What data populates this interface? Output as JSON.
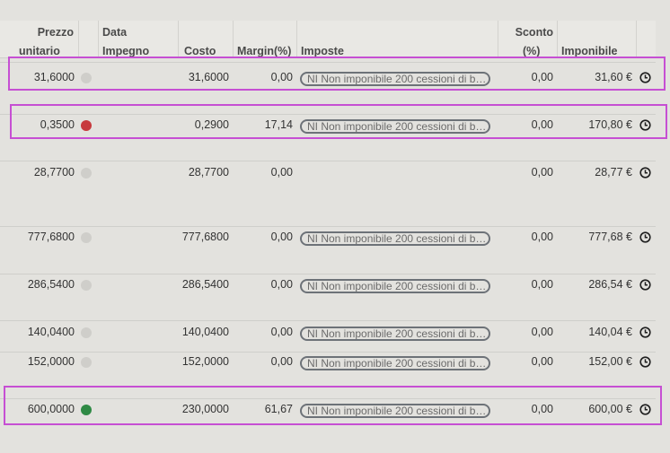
{
  "header": {
    "prezzo_l1": "Prezzo",
    "prezzo_l2": "unitario",
    "data_l1": "Data",
    "data_l2": "Impegno",
    "costo": "Costo",
    "margin": "Margin(%)",
    "imposte": "Imposte",
    "sconto_l1": "Sconto",
    "sconto_l2": "(%)",
    "imponibile": "Imponibile"
  },
  "rows": [
    {
      "prezzo": "31,6000",
      "status": "grey",
      "costo": "31,6000",
      "margin": "0,00",
      "imposte": "NI Non imponibile 200 cessioni di b…",
      "sconto": "0,00",
      "imponibile": "31,60 €"
    },
    {
      "prezzo": "0,3500",
      "status": "red",
      "costo": "0,2900",
      "margin": "17,14",
      "imposte": "NI Non imponibile 200 cessioni di b…",
      "sconto": "0,00",
      "imponibile": "170,80 €"
    },
    {
      "prezzo": "28,7700",
      "status": "grey",
      "costo": "28,7700",
      "margin": "0,00",
      "imposte": "",
      "sconto": "0,00",
      "imponibile": "28,77 €"
    },
    {
      "prezzo": "777,6800",
      "status": "grey",
      "costo": "777,6800",
      "margin": "0,00",
      "imposte": "NI Non imponibile 200 cessioni di b…",
      "sconto": "0,00",
      "imponibile": "777,68 €"
    },
    {
      "prezzo": "286,5400",
      "status": "grey",
      "costo": "286,5400",
      "margin": "0,00",
      "imposte": "NI Non imponibile 200 cessioni di b…",
      "sconto": "0,00",
      "imponibile": "286,54 €"
    },
    {
      "prezzo": "140,0400",
      "status": "grey",
      "costo": "140,0400",
      "margin": "0,00",
      "imposte": "NI Non imponibile 200 cessioni di b…",
      "sconto": "0,00",
      "imponibile": "140,04 €"
    },
    {
      "prezzo": "152,0000",
      "status": "grey",
      "costo": "152,0000",
      "margin": "0,00",
      "imposte": "NI Non imponibile 200 cessioni di b…",
      "sconto": "0,00",
      "imponibile": "152,00 €"
    },
    {
      "prezzo": "600,0000",
      "status": "green",
      "costo": "230,0000",
      "margin": "61,67",
      "imposte": "NI Non imponibile 200 cessioni di b…",
      "sconto": "0,00",
      "imponibile": "600,00 €"
    }
  ],
  "colors": {
    "grey": "#cfceca",
    "red": "#c7393d",
    "green": "#2f8a45",
    "highlight": "#c64fd3"
  },
  "icons": {
    "row_action": "clock-icon"
  }
}
